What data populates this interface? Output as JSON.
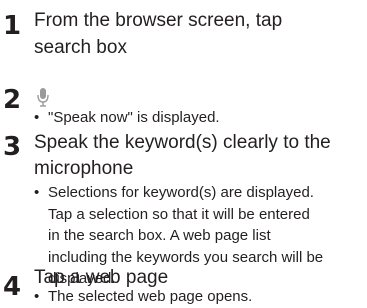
{
  "steps": [
    {
      "number": "1",
      "title_line1": "From the browser screen, tap",
      "title_line2": "search box"
    },
    {
      "number": "2",
      "icon": "microphone-icon",
      "bullet": "\"Speak now\" is displayed."
    },
    {
      "number": "3",
      "title_line1": "Speak the keyword(s) clearly to the",
      "title_line2": "microphone",
      "bullet_lines": [
        "Selections for keyword(s) are displayed.",
        "Tap a selection so that it will be entered",
        "in the search box. A web page list",
        "including the keywords you search will be",
        "displayed."
      ]
    },
    {
      "number": "4",
      "title_line1": "Tap a web page",
      "bullet": "The selected web page opens."
    }
  ],
  "bullet_char": "•",
  "colors": {
    "text": "#231f20",
    "icon": "#9a9a9a"
  }
}
